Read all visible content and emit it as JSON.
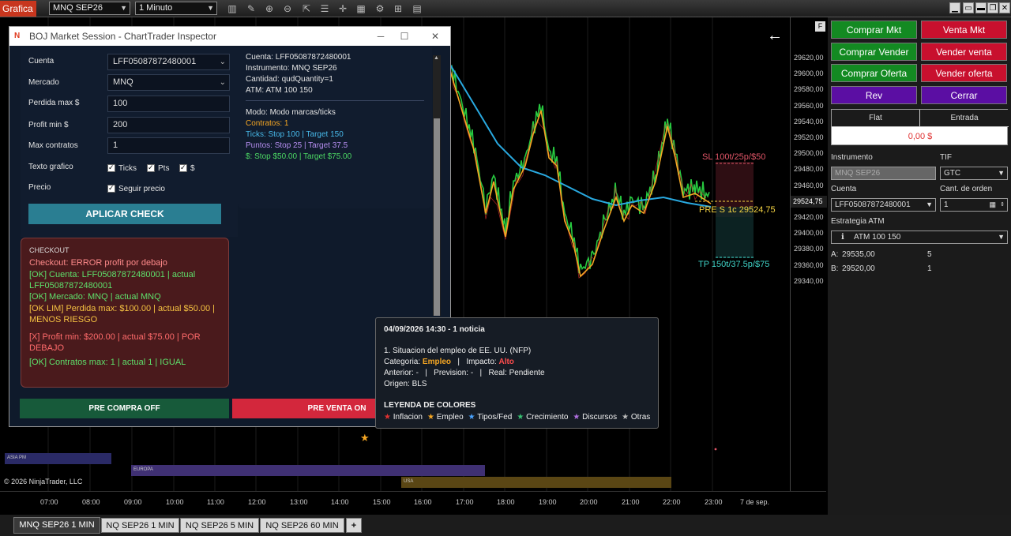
{
  "toolbar": {
    "app_title": "Grafica",
    "instrument": "MNQ SEP26",
    "interval": "1 Minuto"
  },
  "chart": {
    "price_ticks": [
      "29620,00",
      "29600,00",
      "29580,00",
      "29560,00",
      "29540,00",
      "29520,00",
      "29500,00",
      "29480,00",
      "29460,00",
      "29440,00",
      "29420,00",
      "29400,00",
      "29380,00",
      "29360,00",
      "29340,00"
    ],
    "current_price": "29524,75",
    "time_ticks": [
      "07:00",
      "08:00",
      "09:00",
      "10:00",
      "11:00",
      "12:00",
      "13:00",
      "14:00",
      "15:00",
      "16:00",
      "17:00",
      "18:00",
      "19:00",
      "20:00",
      "21:00",
      "22:00",
      "23:00",
      "7 de sep."
    ],
    "sl_label": "SL 100t/25p/$50",
    "pre_label": "PRE S 1c 29524,75",
    "tp_label": "TP 150t/37.5p/$75",
    "copyright": "© 2026 NinjaTrader, LLC",
    "sessions": {
      "asia": "ASIA PM",
      "europa": "EUROPA",
      "usa": "USA"
    },
    "colors": {
      "price": "#27c93f",
      "price_down": "#e03131",
      "ema_fast": "#f5a623",
      "ema_slow": "#29a9e0"
    }
  },
  "panel": {
    "buttons": {
      "buy_mkt": "Comprar Mkt",
      "sell_mkt": "Venta Mkt",
      "buy_ask": "Comprar Vender",
      "sell_ask": "Vender venta",
      "buy_bid": "Comprar Oferta",
      "sell_bid": "Vender oferta",
      "rev": "Rev",
      "close": "Cerrar"
    },
    "position_header": "Flat",
    "entry_header": "Entrada",
    "pnl": "0,00 $",
    "instrument_label": "Instrumento",
    "instrument_value": "MNQ SEP26",
    "tif_label": "TIF",
    "tif_value": "GTC",
    "account_label": "Cuenta",
    "account_value": "LFF05087872480001",
    "qty_label": "Cant. de orden",
    "qty_value": "1",
    "atm_label": "Estrategia ATM",
    "atm_value": "ATM 100 150",
    "ask_label": "A:",
    "ask_price": "29535,00",
    "ask_size": "5",
    "bid_label": "B:",
    "bid_price": "29520,00",
    "bid_size": "1"
  },
  "window": {
    "title": "BOJ Market Session - ChartTrader Inspector",
    "form": {
      "account_label": "Cuenta",
      "account_value": "LFF05087872480001",
      "market_label": "Mercado",
      "market_value": "MNQ",
      "max_loss_label": "Perdida max $",
      "max_loss_value": "100",
      "min_profit_label": "Profit min $",
      "min_profit_value": "200",
      "max_contracts_label": "Max contratos",
      "max_contracts_value": "1",
      "text_label": "Texto grafico",
      "opt_ticks": "Ticks",
      "opt_pts": "Pts",
      "opt_usd": "$",
      "price_label": "Precio",
      "opt_follow": "Seguir precio",
      "apply": "APLICAR CHECK"
    },
    "summary": [
      {
        "text": "Cuenta: LFF05087872480001",
        "color": "#e4e4e4"
      },
      {
        "text": "Instrumento: MNQ SEP26",
        "color": "#e4e4e4"
      },
      {
        "text": "Cantidad: qudQuantity=1",
        "color": "#e4e4e4"
      },
      {
        "text": "ATM: ATM 100 150",
        "color": "#e4e4e4"
      },
      {
        "text": "Modo: Modo marcas/ticks",
        "color": "#e4e4e4"
      },
      {
        "text": "Contratos: 1",
        "color": "#f5a623"
      },
      {
        "text": "Ticks: Stop 100 | Target 150",
        "color": "#47b8e8"
      },
      {
        "text": "Puntos: Stop 25 | Target 37.5",
        "color": "#b58ef0"
      },
      {
        "text": "$: Stop $50.00 | Target $75.00",
        "color": "#4cd964"
      }
    ],
    "checkout": {
      "header": "CHECKOUT",
      "lines": [
        {
          "text": "Checkout: ERROR profit por debajo",
          "color": "#ff8a8a"
        },
        {
          "text": "[OK] Cuenta: LFF05087872480001 | actual LFF05087872480001",
          "color": "#5ee06b"
        },
        {
          "text": "[OK] Mercado: MNQ | actual MNQ",
          "color": "#5ee06b"
        },
        {
          "text": "[OK LIM] Perdida max: $100.00 | actual $50.00 | MENOS RIESGO",
          "color": "#f5c242"
        },
        {
          "text": "[X] Profit min: $200.00 | actual $75.00 | POR DEBAJO",
          "color": "#ff6b6b"
        },
        {
          "text": "[OK] Contratos max: 1 | actual 1 | IGUAL",
          "color": "#5ee06b"
        }
      ]
    },
    "pre_buy": "PRE COMPRA OFF",
    "pre_sell": "PRE VENTA ON"
  },
  "tooltip": {
    "date": "04/09/2026 14:30 - 1 noticia",
    "headline": "1. Situacion del empleo de EE. UU. (NFP)",
    "category_label": "Categoria:",
    "category_value": "Empleo",
    "impact_label": "Impacto:",
    "impact_value": "Alto",
    "details": "Anterior: -   |   Prevision: -   |   Real: Pendiente",
    "origin": "Origen: BLS",
    "legend_title": "LEYENDA DE COLORES",
    "legend": [
      {
        "label": "Inflacion",
        "color": "#e03131"
      },
      {
        "label": "Empleo",
        "color": "#f5a623"
      },
      {
        "label": "Tipos/Fed",
        "color": "#4aa3ff"
      },
      {
        "label": "Crecimiento",
        "color": "#38c172"
      },
      {
        "label": "Discursos",
        "color": "#b06fe0"
      },
      {
        "label": "Otras",
        "color": "#bbbbbb"
      }
    ]
  },
  "tabs": [
    "MNQ SEP26 1 MIN",
    "NQ SEP26 1 MIN",
    "NQ SEP26 5 MIN",
    "NQ SEP26 60 MIN"
  ]
}
